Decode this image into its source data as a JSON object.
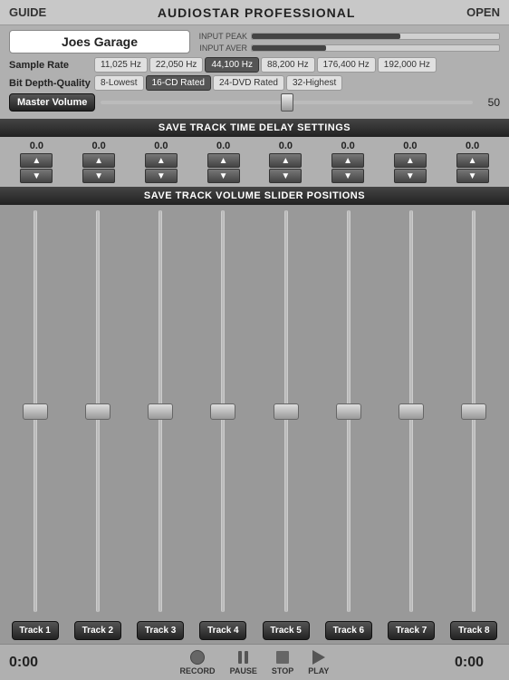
{
  "header": {
    "guide_label": "GUIDE",
    "title": "AUDIOSTAR PROFESSIONAL",
    "open_label": "OPEN"
  },
  "project": {
    "name": "Joes Garage"
  },
  "peak": {
    "input_peak_label": "INPUT PEAK",
    "input_aver_label": "INPUT AVER",
    "peak_fill_width": "60%",
    "aver_fill_width": "30%"
  },
  "sample_rate": {
    "label": "Sample Rate",
    "options": [
      "11,025 Hz",
      "22,050 Hz",
      "44,100 Hz",
      "88,200 Hz",
      "176,400 Hz",
      "192,000 Hz"
    ],
    "active_index": 2
  },
  "bit_depth": {
    "label": "Bit Depth-Quality",
    "options": [
      "8-Lowest",
      "16-CD Rated",
      "24-DVD Rated",
      "32-Highest"
    ],
    "active_index": 1
  },
  "master_volume": {
    "label": "Master Volume",
    "value": "50"
  },
  "save_time_delay": {
    "label": "SAVE TRACK TIME DELAY SETTINGS"
  },
  "delay_values": [
    "0.0",
    "0.0",
    "0.0",
    "0.0",
    "0.0",
    "0.0",
    "0.0",
    "0.0"
  ],
  "save_volume": {
    "label": "SAVE TRACK VOLUME SLIDER POSITIONS"
  },
  "tracks": {
    "buttons": [
      "Track 1",
      "Track 2",
      "Track 3",
      "Track 4",
      "Track 5",
      "Track 6",
      "Track 7",
      "Track 8"
    ]
  },
  "transport": {
    "time_left": "0:00",
    "time_right": "0:00",
    "record_label": "RECORD",
    "pause_label": "PAUSE",
    "stop_label": "STOP",
    "play_label": "PLAY"
  }
}
